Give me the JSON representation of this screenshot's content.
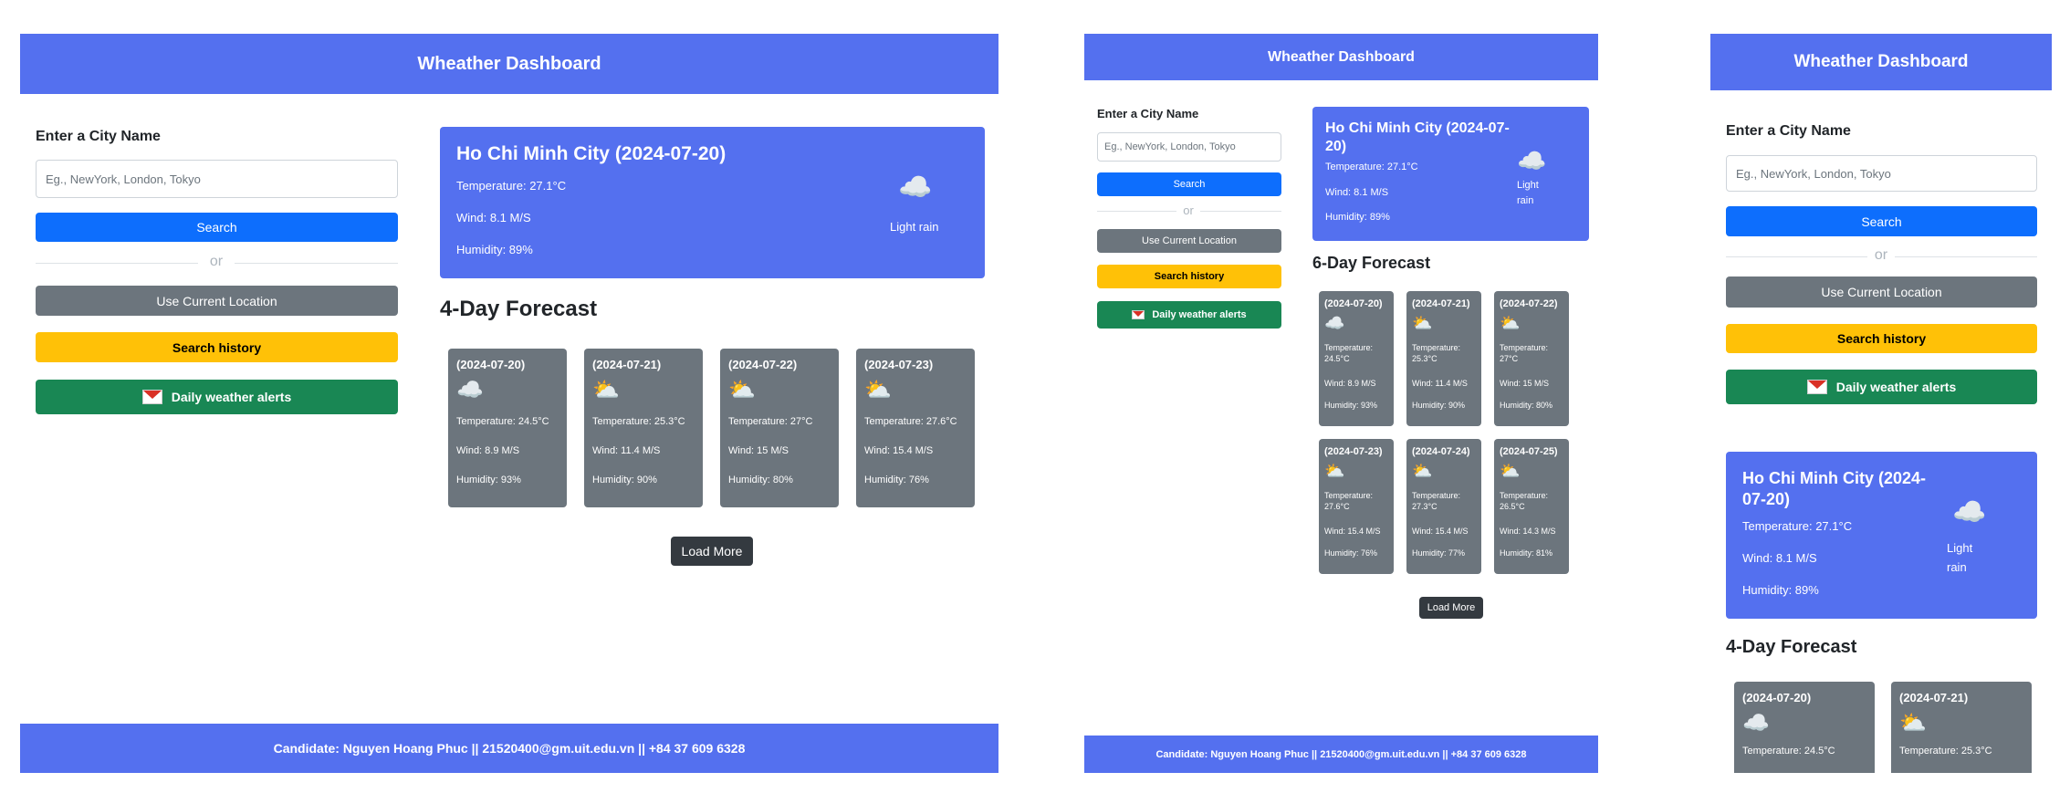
{
  "app": {
    "title": "Wheather Dashboard",
    "footer": "Candidate: Nguyen Hoang Phuc || 21520400@gm.uit.edu.vn || +84 37 609 6328"
  },
  "search": {
    "label": "Enter a City Name",
    "placeholder": "Eg., NewYork, London, Tokyo",
    "button": "Search",
    "or": "or",
    "location_button": "Use Current Location",
    "history_button": "Search history",
    "alerts_button": "Daily weather alerts"
  },
  "current": {
    "title": "Ho Chi Minh City (2024-07-20)",
    "title_line1": "Ho Chi Minh City (2024-07-",
    "title_line2": "20)",
    "title_line1_alt": "Ho Chi Minh City (2024-",
    "title_line2_alt": "07-20)",
    "temperature": "Temperature: 27.1°C",
    "wind": "Wind: 8.1 M/S",
    "humidity": "Humidity: 89%",
    "icon": "☁️",
    "icon_name": "cloud-rain-icon",
    "description": "Light rain",
    "description_line1": "Light",
    "description_line2": "rain"
  },
  "forecast_title_4": "4-Day Forecast",
  "forecast_title_6": "6-Day Forecast",
  "forecast": [
    {
      "date": "(2024-07-20)",
      "icon": "☁️",
      "icon_name": "cloud-icon",
      "temp": "Temperature: 24.5°C",
      "temp_label": "Temperature:",
      "temp_value": "24.5°C",
      "wind": "Wind: 8.9 M/S",
      "humidity": "Humidity: 93%"
    },
    {
      "date": "(2024-07-21)",
      "icon": "⛅",
      "icon_name": "partly-cloudy-icon",
      "temp": "Temperature: 25.3°C",
      "temp_label": "Temperature:",
      "temp_value": "25.3°C",
      "wind": "Wind: 11.4 M/S",
      "humidity": "Humidity: 90%"
    },
    {
      "date": "(2024-07-22)",
      "icon": "⛅",
      "icon_name": "partly-cloudy-icon",
      "temp": "Temperature: 27°C",
      "temp_label": "Temperature:",
      "temp_value": "27°C",
      "wind": "Wind: 15 M/S",
      "humidity": "Humidity: 80%"
    },
    {
      "date": "(2024-07-23)",
      "icon": "⛅",
      "icon_name": "partly-cloudy-icon",
      "temp": "Temperature: 27.6°C",
      "temp_label": "Temperature:",
      "temp_value": "27.6°C",
      "wind": "Wind: 15.4 M/S",
      "humidity": "Humidity: 76%"
    },
    {
      "date": "(2024-07-24)",
      "icon": "⛅",
      "icon_name": "partly-cloudy-icon",
      "temp": "Temperature: 27.3°C",
      "temp_label": "Temperature:",
      "temp_value": "27.3°C",
      "wind": "Wind: 15.4 M/S",
      "humidity": "Humidity: 77%"
    },
    {
      "date": "(2024-07-25)",
      "icon": "⛅",
      "icon_name": "partly-cloudy-icon",
      "temp": "Temperature: 26.5°C",
      "temp_label": "Temperature:",
      "temp_value": "26.5°C",
      "wind": "Wind: 14.3 M/S",
      "humidity": "Humidity: 81%"
    }
  ],
  "load_more": "Load More",
  "colors": {
    "header": "#5470ef",
    "search_button": "#0d6efd",
    "location_button": "#6c757d",
    "history_button": "#ffc107",
    "alerts_button": "#198754",
    "forecast_card": "#6c757d",
    "load_more": "#343a40"
  }
}
